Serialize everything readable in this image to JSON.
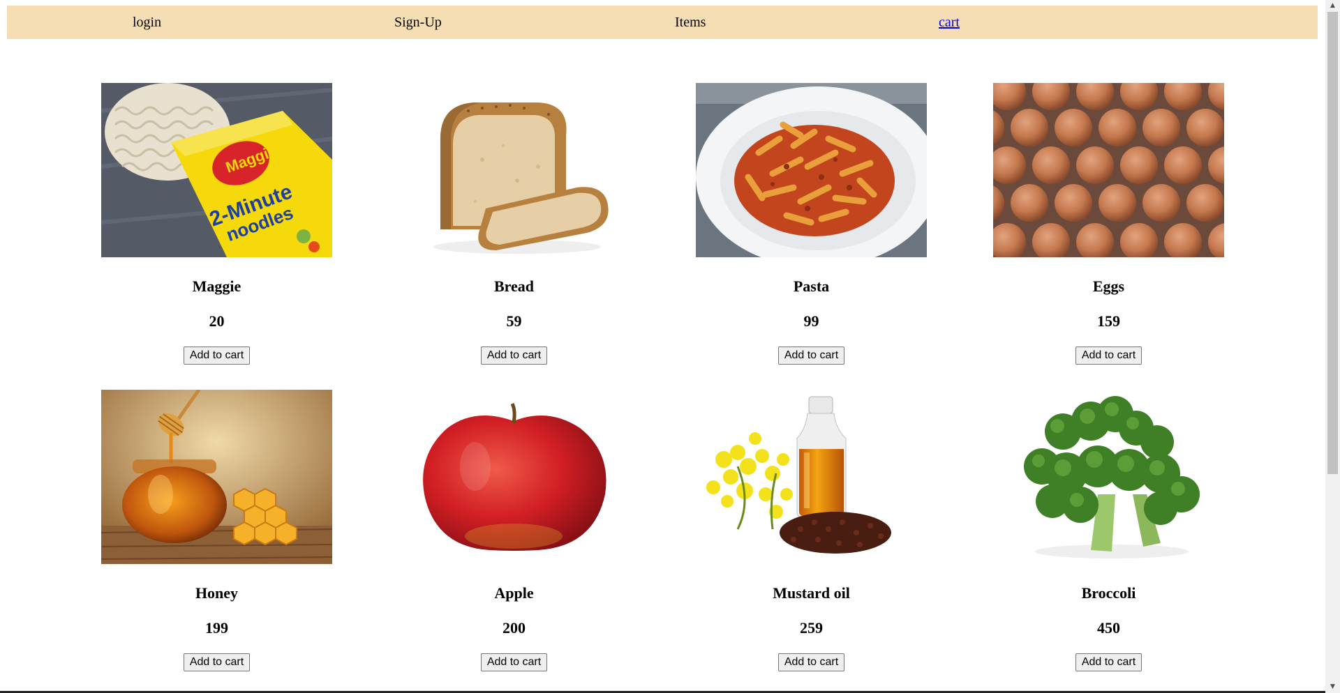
{
  "nav": {
    "login": "login",
    "signup": "Sign-Up",
    "items": "Items",
    "cart": "cart"
  },
  "products": [
    {
      "name": "Maggie",
      "price": "20",
      "button": "Add to cart",
      "image": "maggie-noodles-image"
    },
    {
      "name": "Bread",
      "price": "59",
      "button": "Add to cart",
      "image": "bread-image"
    },
    {
      "name": "Pasta",
      "price": "99",
      "button": "Add to cart",
      "image": "pasta-image"
    },
    {
      "name": "Eggs",
      "price": "159",
      "button": "Add to cart",
      "image": "eggs-image"
    },
    {
      "name": "Honey",
      "price": "199",
      "button": "Add to cart",
      "image": "honey-image"
    },
    {
      "name": "Apple",
      "price": "200",
      "button": "Add to cart",
      "image": "apple-image"
    },
    {
      "name": "Mustard oil",
      "price": "259",
      "button": "Add to cart",
      "image": "mustard-oil-image"
    },
    {
      "name": "Broccoli",
      "price": "450",
      "button": "Add to cart",
      "image": "broccoli-image"
    }
  ],
  "colors": {
    "navbar_bg": "#f5deb3",
    "link": "#0000ee"
  }
}
